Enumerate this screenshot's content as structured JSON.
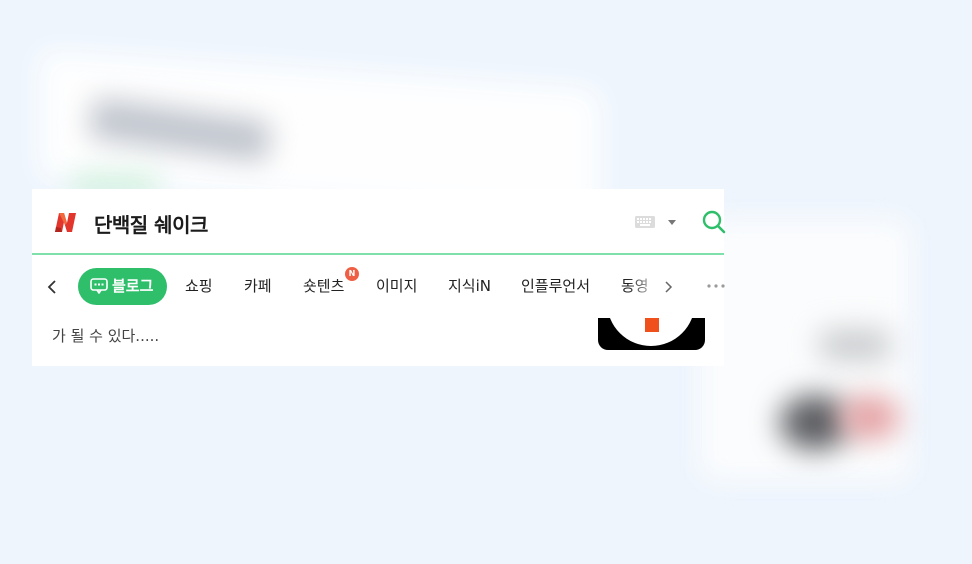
{
  "search": {
    "query": "단백질 쉐이크"
  },
  "tabs": [
    {
      "label": "블로그",
      "active": true
    },
    {
      "label": "쇼핑"
    },
    {
      "label": "카페"
    },
    {
      "label": "숏텐츠",
      "badge": "N"
    },
    {
      "label": "이미지"
    },
    {
      "label": "지식iN"
    },
    {
      "label": "인플루언서"
    },
    {
      "label": "동영"
    }
  ],
  "result": {
    "snippet": "가 될 수 있다....."
  },
  "icons": {
    "logo": "naver-logo-icon",
    "keyboard": "keyboard-icon",
    "dropdown": "caret-down-icon",
    "search": "search-icon",
    "prev": "chevron-left-icon",
    "next": "chevron-right-icon",
    "more": "more-dots-icon",
    "blog": "blog-icon"
  },
  "colors": {
    "accent": "#2fbf6b",
    "search_line": "#7fe0ab",
    "badge": "#ef5f44",
    "logo_red": "#e2352c"
  }
}
